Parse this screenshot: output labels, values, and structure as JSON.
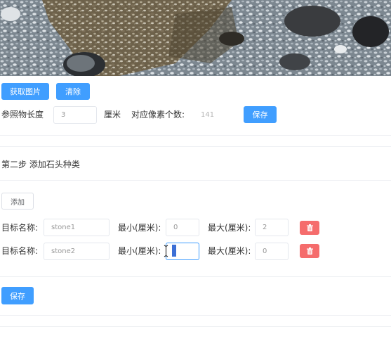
{
  "colors": {
    "primary": "#409eff",
    "danger": "#f56c6c",
    "border": "#dcdfe6"
  },
  "image": {
    "icon": "gravel-stones-photo"
  },
  "step1": {
    "fetch_image_label": "获取图片",
    "clear_label": "清除",
    "ref_length_label": "参照物长度",
    "ref_length_value": "3",
    "unit_label": "厘米",
    "pixel_count_label": "对应像素个数:",
    "pixel_count_value": "141",
    "save_label": "保存"
  },
  "step2": {
    "title": "第二步 添加石头种类",
    "add_label": "添加",
    "rows": [
      {
        "name_label": "目标名称:",
        "name_value": "stone1",
        "min_label": "最小(厘米):",
        "min_value": "0",
        "max_label": "最大(厘米):",
        "max_value": "2",
        "delete_icon": "trash-icon"
      },
      {
        "name_label": "目标名称:",
        "name_value": "stone2",
        "min_label": "最小(厘米):",
        "min_value": "0",
        "max_label": "最大(厘米):",
        "max_value": "0",
        "delete_icon": "trash-icon"
      }
    ],
    "save_label": "保存"
  }
}
